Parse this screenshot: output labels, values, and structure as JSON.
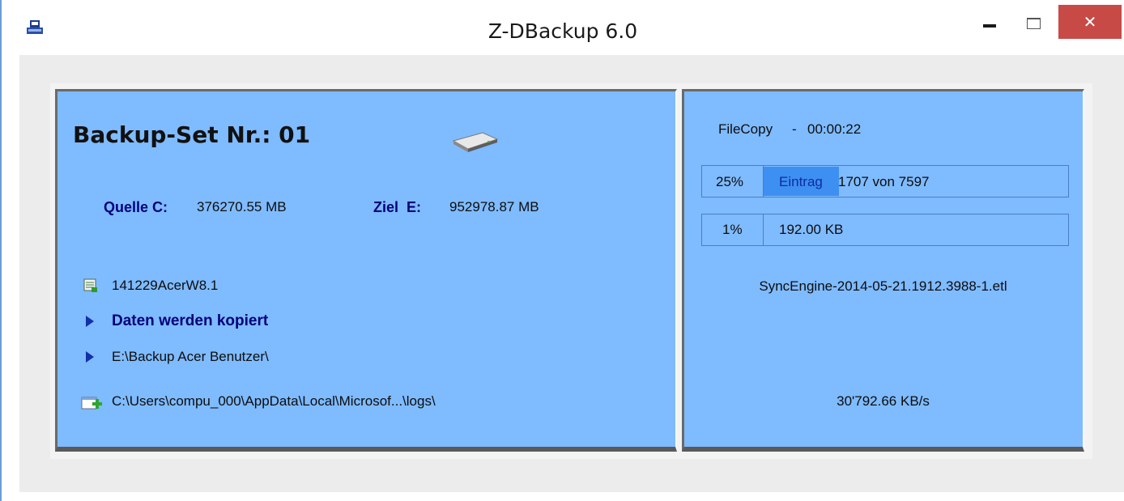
{
  "window": {
    "title": "Z-DBackup 6.0",
    "controls": {
      "close_glyph": "✕"
    },
    "colors": {
      "panel": "#7fbbff",
      "progress_fill": "#3e8ff2",
      "label_blue": "#00007a",
      "close_button": "#c74a47"
    }
  },
  "left_panel": {
    "set_title": "Backup-Set Nr.: 01",
    "drive_icon": "hard-drive-icon",
    "source": {
      "label": "Quelle C:",
      "value": "376270.55 MB"
    },
    "target": {
      "label": "Ziel  E:",
      "value": "952978.87 MB"
    },
    "set_name": "141229AcerW8.1",
    "status": "Daten werden kopiert",
    "destination_path": "E:\\Backup Acer Benutzer\\",
    "source_path": "C:\\Users\\compu_000\\AppData\\Local\\Microsof...\\logs\\"
  },
  "right_panel": {
    "operation": "FileCopy",
    "separator": "-",
    "elapsed": "00:00:22",
    "overall": {
      "percent_label": "25%",
      "percent": 25,
      "entry_label": "Eintrag",
      "entry_value": "1707 von 7597"
    },
    "file": {
      "percent_label": "1%",
      "percent": 1,
      "size": "192.00 KB"
    },
    "current_file": "SyncEngine-2014-05-21.1912.3988-1.etl",
    "speed": "30'792.66 KB/s"
  }
}
